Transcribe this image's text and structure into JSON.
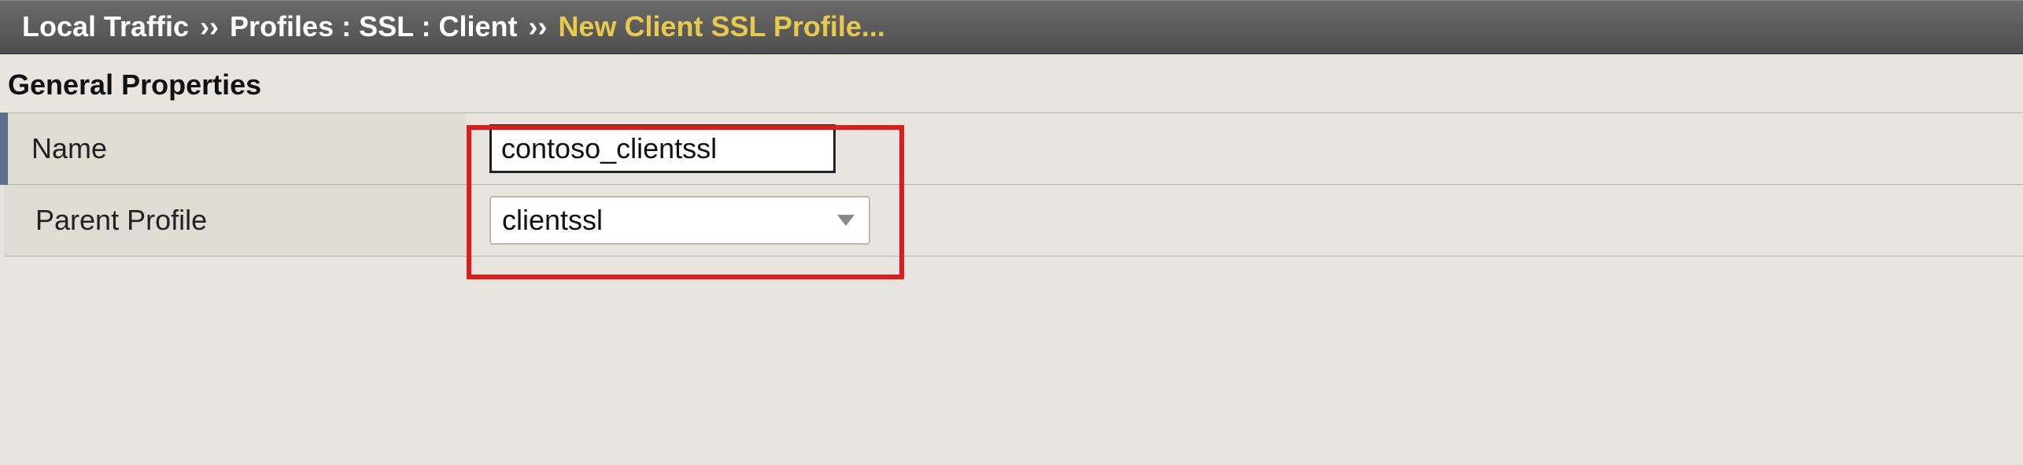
{
  "breadcrumb": {
    "root": "Local Traffic",
    "sep1": "››",
    "path": "Profiles : SSL : Client",
    "sep2": "››",
    "current": "New Client SSL Profile..."
  },
  "section": {
    "title": "General Properties"
  },
  "fields": {
    "name": {
      "label": "Name",
      "value": "contoso_clientssl"
    },
    "parent_profile": {
      "label": "Parent Profile",
      "value": "clientssl"
    }
  }
}
